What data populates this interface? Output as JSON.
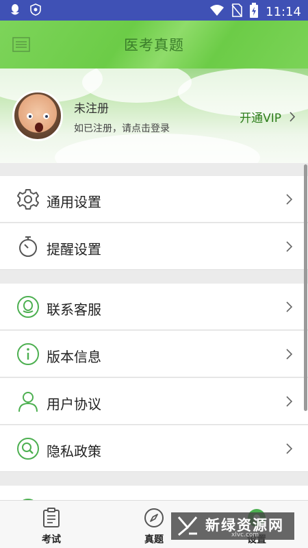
{
  "status_bar": {
    "time": "11:14"
  },
  "app_bar": {
    "title": "医考真题"
  },
  "profile": {
    "user_name": "未注册",
    "login_hint": "如已注册，请点击登录",
    "vip_label": "开通VIP"
  },
  "settings_groups": [
    {
      "items": [
        {
          "label": "通用设置",
          "icon": "gear-icon"
        },
        {
          "label": "提醒设置",
          "icon": "stopwatch-icon"
        }
      ]
    },
    {
      "items": [
        {
          "label": "联系客服",
          "icon": "qq-service-icon"
        },
        {
          "label": "版本信息",
          "icon": "info-icon"
        },
        {
          "label": "用户协议",
          "icon": "user-icon"
        },
        {
          "label": "隐私政策",
          "icon": "privacy-search-icon"
        }
      ]
    }
  ],
  "tab_bar": {
    "tabs": [
      {
        "label": "考试",
        "icon": "exam-document-icon",
        "active": false
      },
      {
        "label": "真题",
        "icon": "compass-icon",
        "active": false
      },
      {
        "label": "设置",
        "icon": "settings-icon",
        "active": true
      }
    ]
  },
  "watermark": {
    "text": "新绿资源网",
    "url": "xlvc.com"
  },
  "colors": {
    "accent_green": "#6ccc47",
    "status_bar": "#3f51b5",
    "icon_green": "#4caf50"
  }
}
